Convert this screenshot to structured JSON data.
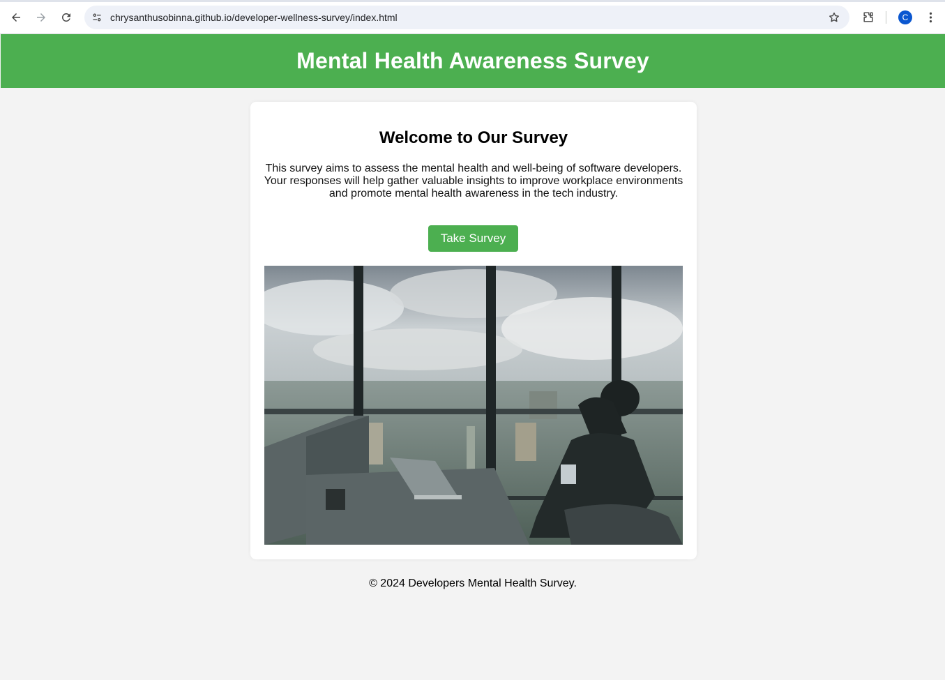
{
  "browser": {
    "url": "chrysanthusobinna.github.io/developer-wellness-survey/index.html",
    "profile_initial": "C",
    "icons": [
      "back-icon",
      "forward-icon",
      "reload-icon",
      "site-info-icon",
      "star-icon",
      "extensions-icon",
      "more-menu-icon"
    ]
  },
  "header": {
    "title": "Mental Health Awareness Survey"
  },
  "main": {
    "heading": "Welcome to Our Survey",
    "intro": "This survey aims to assess the mental health and well-being of software developers. Your responses will help gather valuable insights to improve workplace environments and promote mental health awareness in the tech industry.",
    "cta_label": "Take Survey"
  },
  "footer": {
    "text": "© 2024 Developers Mental Health Survey."
  },
  "colors": {
    "brand": "#4caf50",
    "background": "#f3f3f3",
    "card": "#ffffff"
  }
}
